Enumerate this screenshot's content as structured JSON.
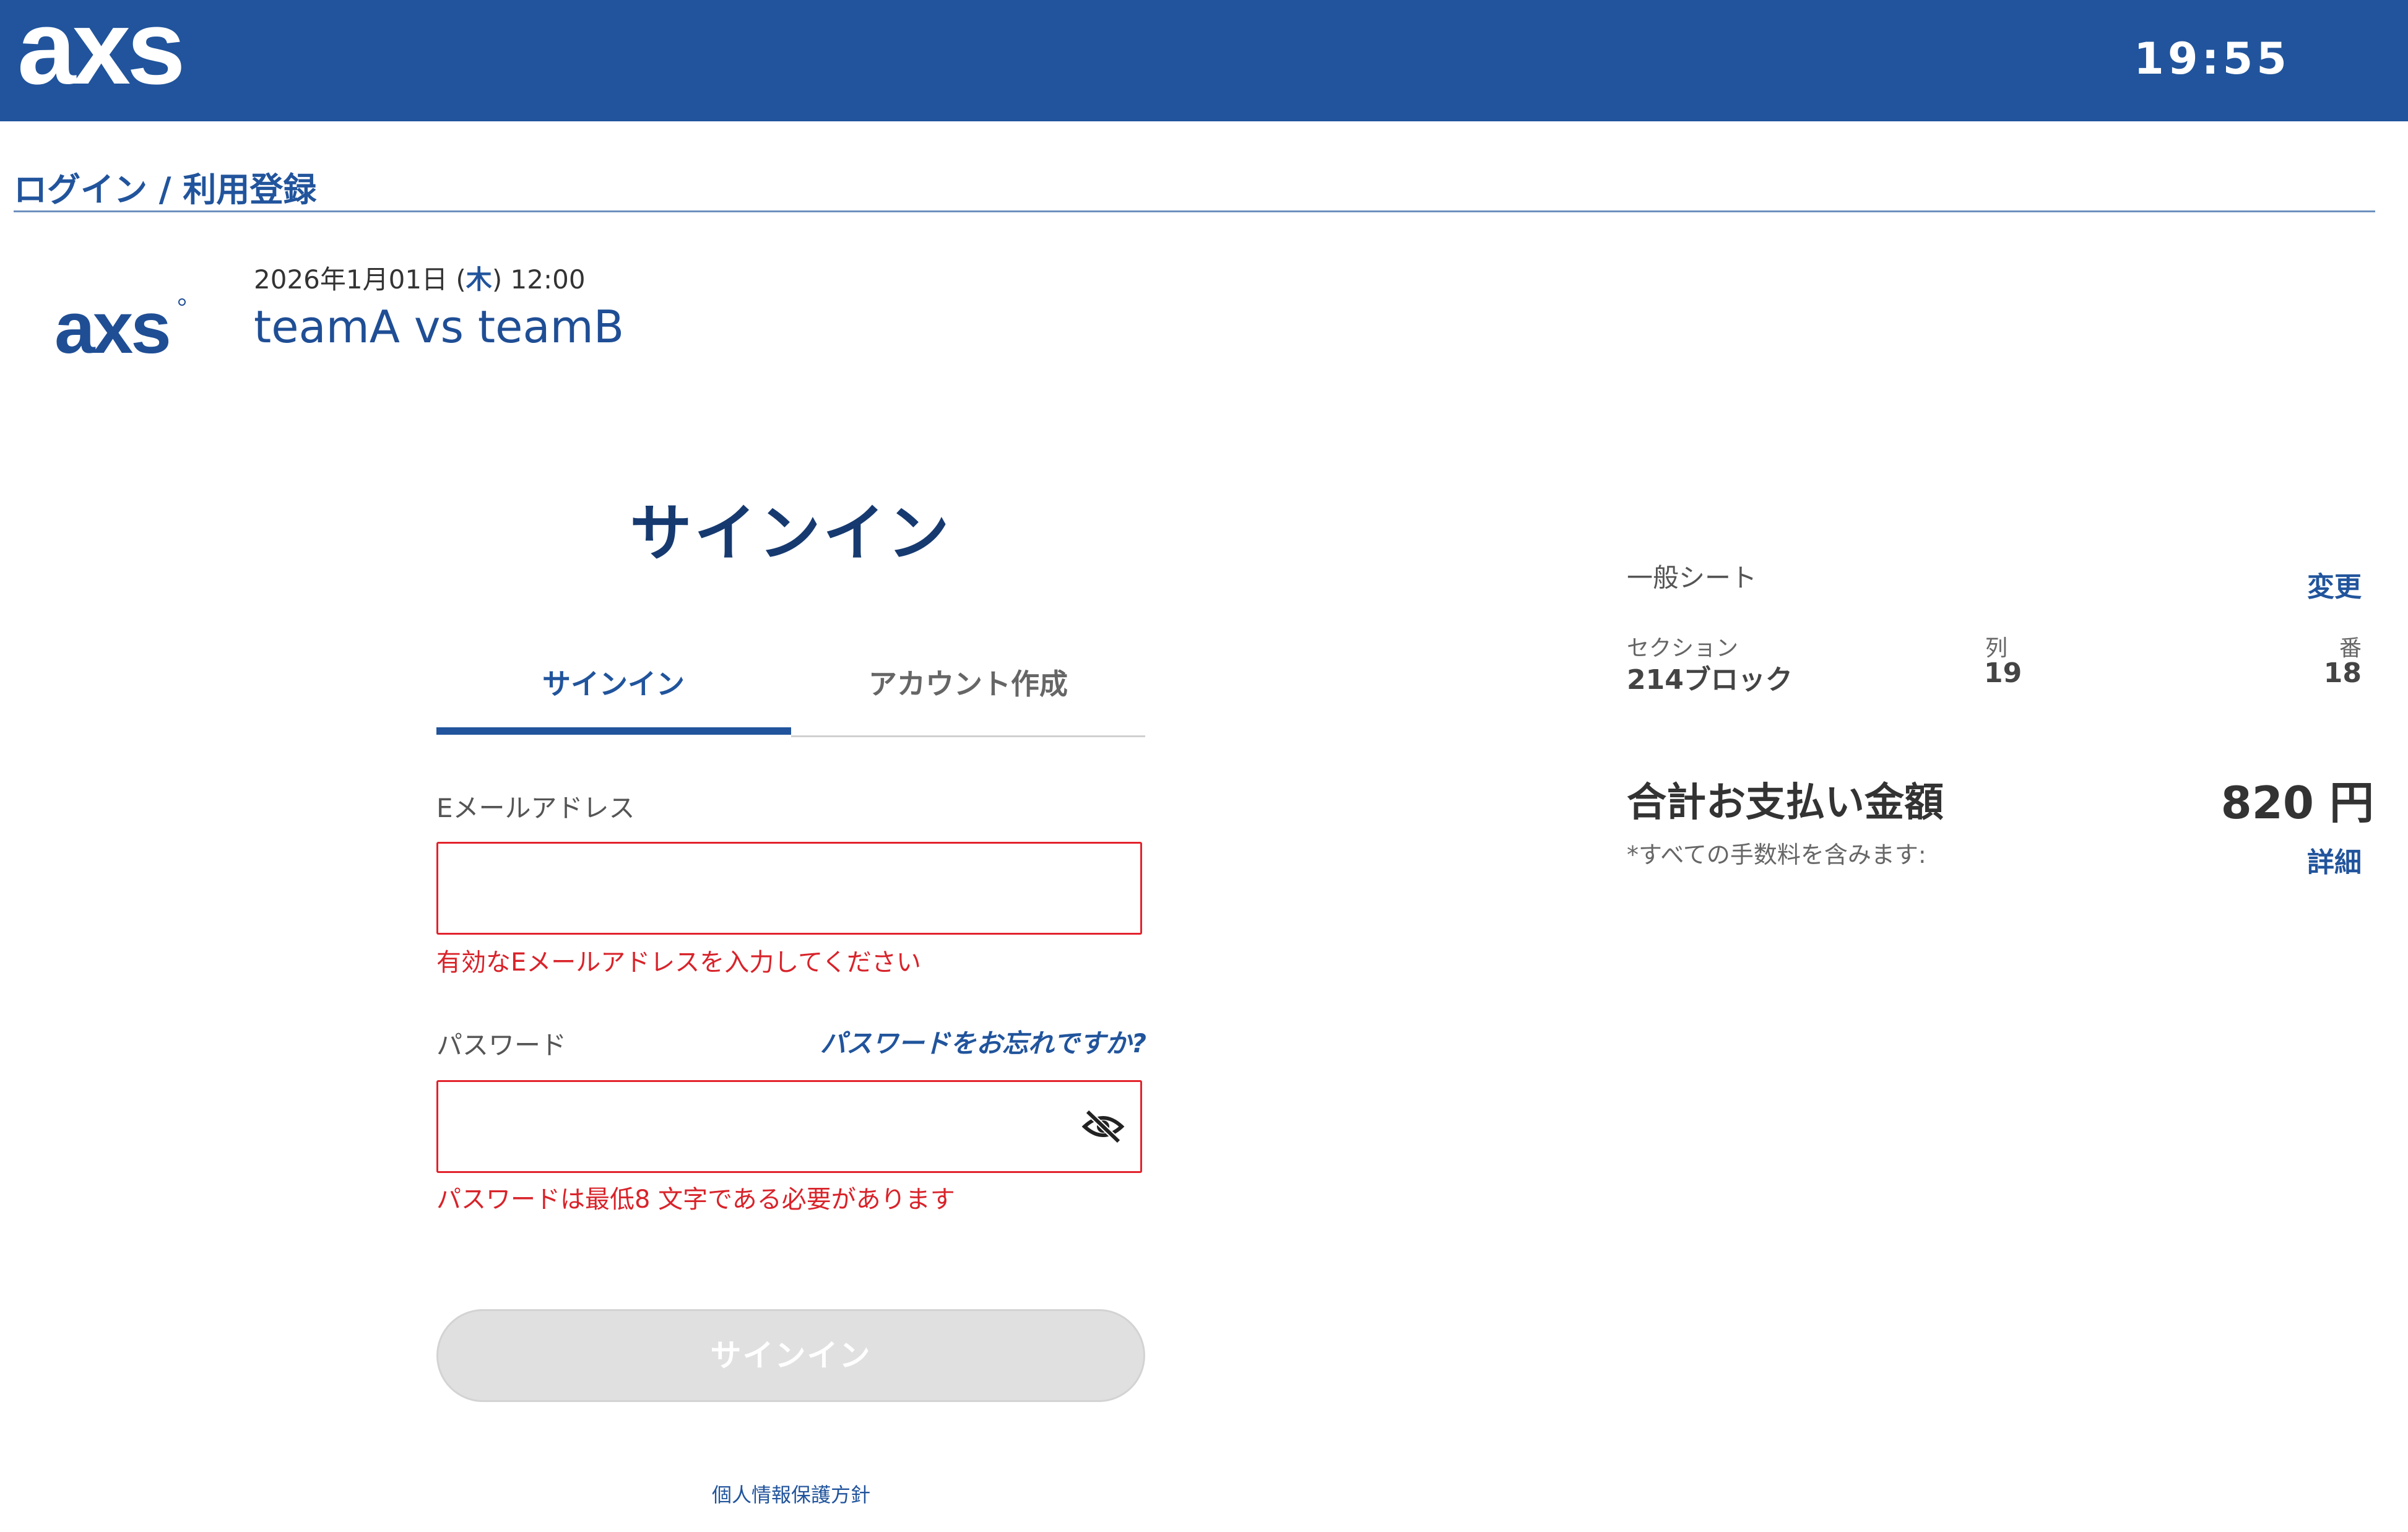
{
  "header": {
    "logo_text": "axs",
    "clock": "19:55",
    "brand_color": "#21549c"
  },
  "breadcrumb": {
    "title": "ログイン / 利用登録"
  },
  "event": {
    "logo_text": "axs",
    "date_prefix": "2026年1月01日 (",
    "weekday": "木",
    "date_suffix": ") 12:00",
    "title": "teamA vs teamB"
  },
  "signin": {
    "heading": "サインイン",
    "tabs": [
      {
        "label": "サインイン",
        "active": true
      },
      {
        "label": "アカウント作成",
        "active": false
      }
    ],
    "email": {
      "label": "Eメールアドレス",
      "value": "",
      "error": "有効なEメールアドレスを入力してください"
    },
    "password": {
      "label": "パスワード",
      "forgot_label": "パスワードをお忘れですか?",
      "value": "",
      "toggle_icon": "eye-slash-icon",
      "error": "パスワードは最低8 文字である必要があります"
    },
    "submit_label": "サインイン",
    "privacy_label": "個人情報保護方針",
    "error_color": "#e3222c"
  },
  "summary": {
    "seat_type": "一般シート",
    "change_label": "変更",
    "section_head": "セクション",
    "section_value": "214ブロック",
    "row_head": "列",
    "row_value": "19",
    "number_head": "番",
    "number_value": "18",
    "total_label": "合計お支払い金額",
    "total_amount": "820 円",
    "fee_note": "*すべての手数料を含みます:",
    "detail_label": "詳細"
  }
}
